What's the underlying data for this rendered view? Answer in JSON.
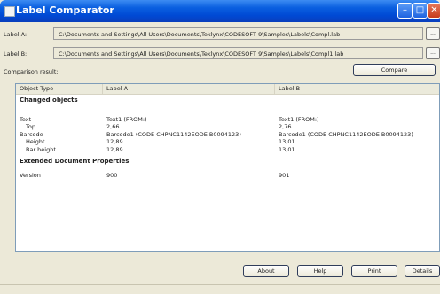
{
  "window": {
    "title": "Label Comparator"
  },
  "labelA": {
    "caption": "Label A:",
    "path": "C:\\Documents and Settings\\All Users\\Documents\\Teklynx\\CODESOFT 9\\Samples\\Labels\\Compl.lab"
  },
  "labelB": {
    "caption": "Label B:",
    "path": "C:\\Documents and Settings\\All Users\\Documents\\Teklynx\\CODESOFT 9\\Samples\\Labels\\Compl1.lab"
  },
  "browse_label": "...",
  "comparison": {
    "caption": "Comparison result:",
    "compare_button": "Compare"
  },
  "table": {
    "headers": [
      "Object Type",
      "Label A",
      "Label B"
    ],
    "sections": [
      {
        "title": "Changed objects",
        "rows": [
          {
            "type": "Text",
            "a": "Text1 (FROM:)",
            "b": "Text1 (FROM:)"
          },
          {
            "type": "Top",
            "a": "2,66",
            "b": "2,76"
          },
          {
            "type": "Barcode",
            "a": "Barcode1 (CODE CHPNC1142EODE B0094123)",
            "b": "Barcode1 (CODE CHPNC1142EODE B0094123)"
          },
          {
            "type": "Height",
            "a": "12,89",
            "b": "13,01"
          },
          {
            "type": "Bar height",
            "a": "12,89",
            "b": "13,01"
          }
        ]
      },
      {
        "title": "Extended Document Properties",
        "rows": [
          {
            "type": "Version",
            "a": "900",
            "b": "901"
          }
        ]
      }
    ]
  },
  "buttons": {
    "about": "About",
    "help": "Help",
    "print": "Print",
    "details": "Details"
  }
}
